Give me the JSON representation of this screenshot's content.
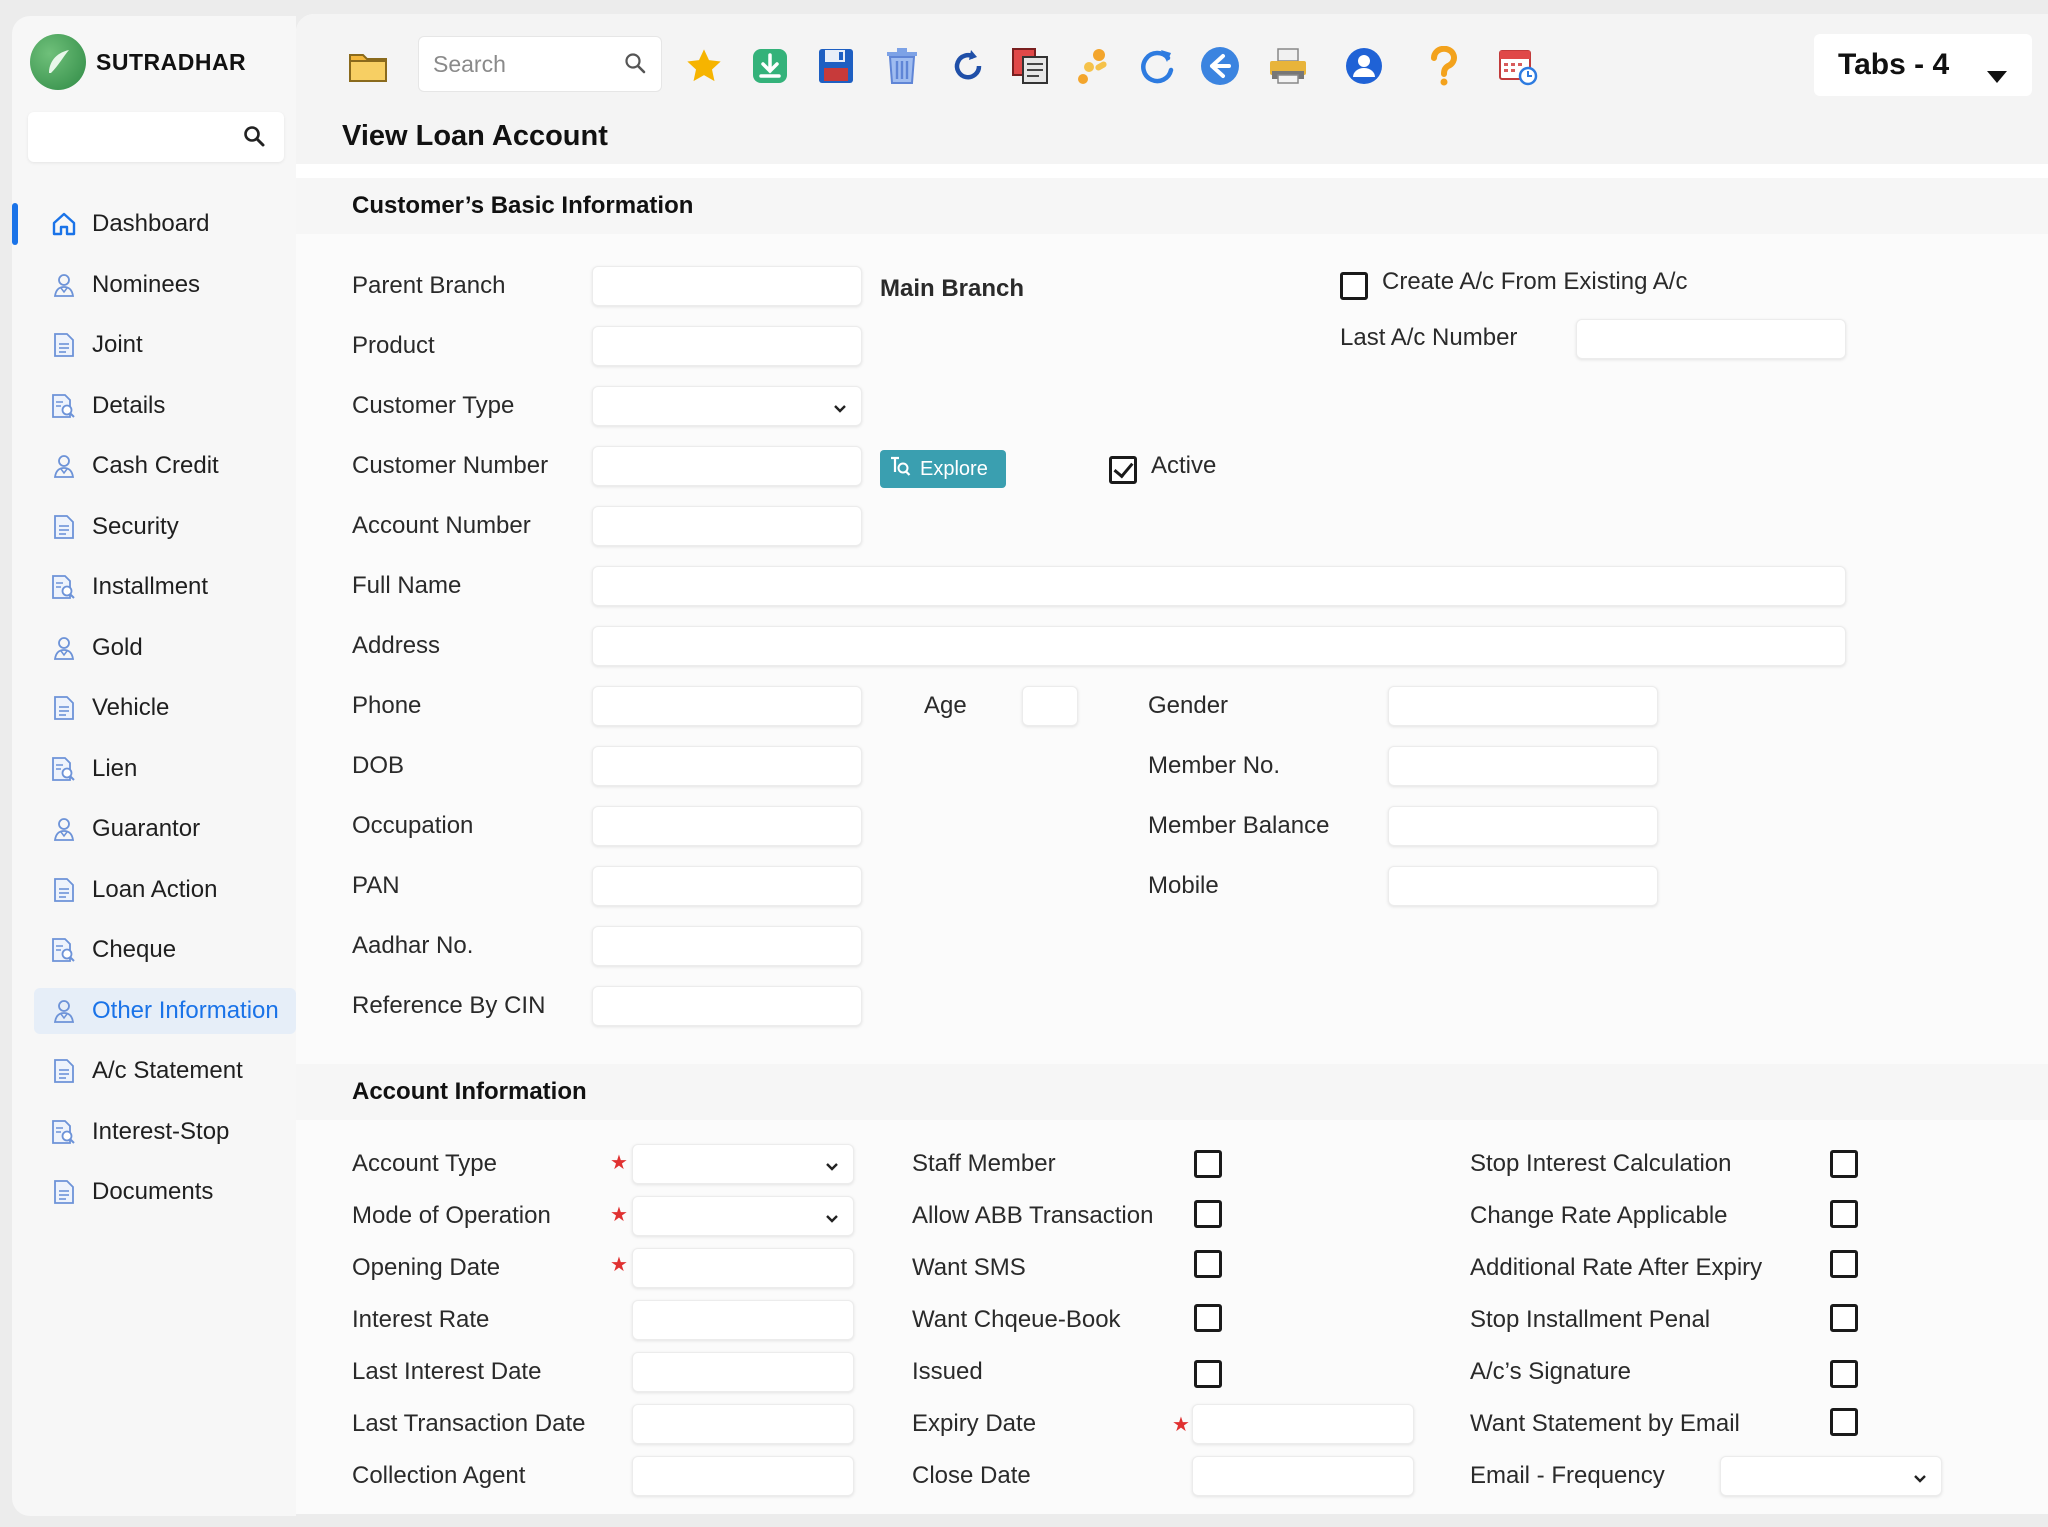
{
  "app": {
    "name": "SUTRADHAR",
    "brand_color": "#3a9a4e",
    "accent_color": "#1a73e8"
  },
  "sidebar": {
    "search_placeholder": "",
    "items": [
      {
        "label": "Dashboard",
        "icon": "home-icon"
      },
      {
        "label": "Nominees",
        "icon": "user-icon"
      },
      {
        "label": "Joint",
        "icon": "document-icon"
      },
      {
        "label": "Details",
        "icon": "document-search-icon"
      },
      {
        "label": "Cash Credit",
        "icon": "user-icon"
      },
      {
        "label": "Security",
        "icon": "document-icon"
      },
      {
        "label": "Installment",
        "icon": "document-search-icon"
      },
      {
        "label": "Gold",
        "icon": "user-icon"
      },
      {
        "label": "Vehicle",
        "icon": "document-icon"
      },
      {
        "label": "Lien",
        "icon": "document-search-icon"
      },
      {
        "label": "Guarantor",
        "icon": "user-icon"
      },
      {
        "label": "Loan Action",
        "icon": "document-icon"
      },
      {
        "label": "Cheque",
        "icon": "document-search-icon"
      },
      {
        "label": "Other Information",
        "icon": "user-icon"
      },
      {
        "label": "A/c Statement",
        "icon": "document-icon"
      },
      {
        "label": "Interest-Stop",
        "icon": "document-search-icon"
      },
      {
        "label": "Documents",
        "icon": "document-icon"
      }
    ],
    "selected": "Other Information"
  },
  "toolbar": {
    "search_placeholder": "Search",
    "icons": [
      "folder-icon",
      "favorite-star-icon",
      "download-icon",
      "save-icon",
      "delete-icon",
      "undo-icon",
      "copy-icon",
      "tools-icon",
      "refresh-icon",
      "back-icon",
      "print-icon",
      "user-account-icon",
      "help-icon",
      "calendar-icon"
    ],
    "tabs_label": "Tabs - 4"
  },
  "page": {
    "title": "View Loan Account"
  },
  "basic_info": {
    "heading": "Customer’s Basic Information",
    "parent_branch": "Parent Branch",
    "main_branch": "Main Branch",
    "create_from_existing": "Create A/c From Existing A/c",
    "last_ac_number": "Last A/c Number",
    "product": "Product",
    "customer_type": "Customer Type",
    "customer_number": "Customer Number",
    "explore": "Explore",
    "active": "Active",
    "account_number": "Account Number",
    "full_name": "Full Name",
    "address": "Address",
    "phone": "Phone",
    "age": "Age",
    "gender": "Gender",
    "dob": "DOB",
    "member_no": "Member No.",
    "occupation": "Occupation",
    "member_balance": "Member Balance",
    "pan": "PAN",
    "mobile": "Mobile",
    "aadhar": "Aadhar No.",
    "reference_by_cin": "Reference By CIN"
  },
  "account_info": {
    "heading": "Account Information",
    "account_type": "Account Type",
    "mode_of_operation": "Mode of Operation",
    "opening_date": "Opening Date",
    "interest_rate": "Interest Rate",
    "last_interest_date": "Last Interest Date",
    "last_transaction_date": "Last Transaction Date",
    "collection_agent": "Collection Agent",
    "staff_member": "Staff Member",
    "allow_abb": "Allow ABB Transaction",
    "want_sms": "Want SMS",
    "want_cheque_book": "Want Chqeue-Book",
    "issued": "Issued",
    "expiry_date": "Expiry Date",
    "close_date": "Close Date",
    "stop_interest_calc": "Stop Interest Calculation",
    "change_rate": "Change Rate Applicable",
    "additional_rate": "Additional Rate After Expiry",
    "stop_installment_penal": "Stop Installment Penal",
    "ac_signature": "A/c’s Signature",
    "want_statement_email": "Want Statement by Email",
    "email_frequency": "Email - Frequency"
  }
}
